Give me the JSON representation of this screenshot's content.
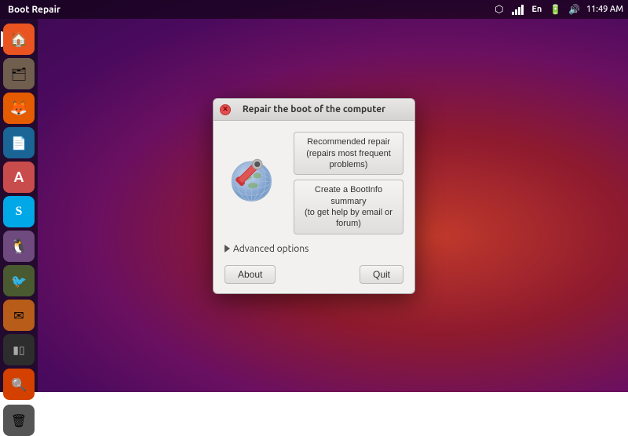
{
  "window_title": "Boot Repair",
  "taskbar": {
    "title": "Boot Repair",
    "time": "11:49 AM",
    "tray_icons": [
      "dropbox",
      "signal",
      "en",
      "battery",
      "speaker"
    ]
  },
  "sidebar": {
    "items": [
      {
        "id": "home",
        "label": "Home",
        "icon": "🏠",
        "bg": "#e95420",
        "active": true
      },
      {
        "id": "files",
        "label": "Files",
        "icon": "🗂",
        "bg": "#705e4f"
      },
      {
        "id": "firefox",
        "label": "Firefox",
        "icon": "🦊",
        "bg": "#e55b00"
      },
      {
        "id": "writer",
        "label": "LibreOffice Writer",
        "icon": "📄",
        "bg": "#1a6496"
      },
      {
        "id": "software",
        "label": "Software Center",
        "icon": "🅰",
        "bg": "#c94c4c"
      },
      {
        "id": "skype",
        "label": "Skype",
        "icon": "S",
        "bg": "#00a8e8"
      },
      {
        "id": "uca",
        "label": "UCA",
        "icon": "🐧",
        "bg": "#7e4c96"
      },
      {
        "id": "bird",
        "label": "Bird",
        "icon": "🐦",
        "bg": "#4a5a30"
      },
      {
        "id": "email",
        "label": "Email",
        "icon": "✉",
        "bg": "#b85c1a"
      },
      {
        "id": "terminal",
        "label": "Terminal",
        "icon": "⬛",
        "bg": "#2d2d2d"
      },
      {
        "id": "search",
        "label": "Search",
        "icon": "🔍",
        "bg": "#d44000"
      },
      {
        "id": "trash",
        "label": "Trash",
        "icon": "🗑",
        "bg": "#555"
      }
    ]
  },
  "dialog": {
    "title": "Repair the boot of the computer",
    "recommended_repair_line1": "Recommended repair",
    "recommended_repair_line2": "(repairs most frequent problems)",
    "bootinfo_line1": "Create a BootInfo summary",
    "bootinfo_line2": "(to get help by email or forum)",
    "advanced_options_label": "Advanced options",
    "about_label": "About",
    "quit_label": "Quit"
  }
}
